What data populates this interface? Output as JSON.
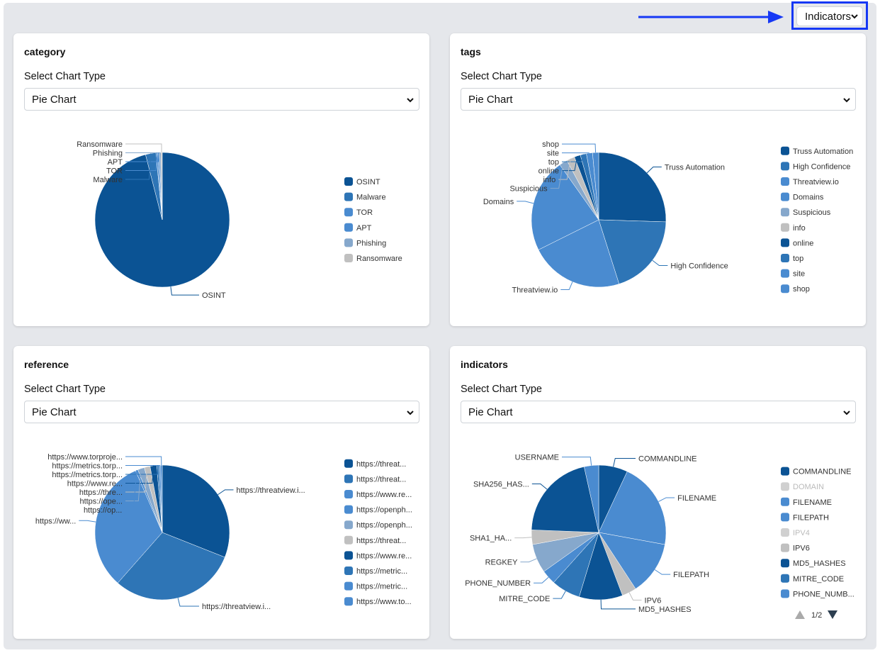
{
  "top_selector": {
    "value": "Indicators"
  },
  "cards": [
    {
      "title": "category",
      "select_label": "Select Chart Type",
      "chart_type": "Pie Chart"
    },
    {
      "title": "tags",
      "select_label": "Select Chart Type",
      "chart_type": "Pie Chart"
    },
    {
      "title": "reference",
      "select_label": "Select Chart Type",
      "chart_type": "Pie Chart"
    },
    {
      "title": "indicators",
      "select_label": "Select Chart Type",
      "chart_type": "Pie Chart"
    }
  ],
  "colors": [
    "#0b5394",
    "#2e75b6",
    "#4a8bd0",
    "#4a8bd0",
    "#86a8cc",
    "#c0c0c0",
    "#0b5394",
    "#2e75b6",
    "#4a8bd0",
    "#4a8bd0",
    "#86a8cc"
  ],
  "chart_data": [
    {
      "type": "pie",
      "title": "category",
      "categories": [
        "OSINT",
        "Malware",
        "TOR",
        "APT",
        "Phishing",
        "Ransomware"
      ],
      "values": [
        96,
        2.5,
        0.4,
        0.4,
        0.4,
        0.3
      ],
      "colors": [
        "#0b5394",
        "#2e75b6",
        "#4a8bd0",
        "#4a8bd0",
        "#86a8cc",
        "#c0c0c0"
      ],
      "legend": [
        "OSINT",
        "Malware",
        "TOR",
        "APT",
        "Phishing",
        "Ransomware"
      ],
      "legend_position": "right"
    },
    {
      "type": "pie",
      "title": "tags",
      "categories": [
        "Truss Automation",
        "High Confidence",
        "Threatview.io",
        "Domains",
        "Suspicious",
        "info",
        "online",
        "top",
        "site",
        "shop"
      ],
      "values": [
        26,
        20,
        23,
        23,
        2,
        2,
        1.5,
        1.5,
        1.5,
        1.5
      ],
      "colors": [
        "#0b5394",
        "#2e75b6",
        "#4a8bd0",
        "#4a8bd0",
        "#86a8cc",
        "#c0c0c0",
        "#0b5394",
        "#2e75b6",
        "#4a8bd0",
        "#4a8bd0"
      ],
      "legend": [
        "Truss Automation",
        "High Confidence",
        "Threatview.io",
        "Domains",
        "Suspicious",
        "info",
        "online",
        "top",
        "site",
        "shop"
      ],
      "legend_position": "right"
    },
    {
      "type": "pie",
      "title": "reference",
      "categories": [
        "https://threatview.i...",
        "https://threatview.i...",
        "https://ww...",
        "https://op...",
        "https://ope...",
        "https://thre...",
        "https://www.re...",
        "https://metrics.torp...",
        "https://metrics.torp...",
        "https://www.torproje..."
      ],
      "values": [
        31,
        30.5,
        32,
        0.6,
        1.6,
        1.4,
        1.6,
        0.5,
        0.4,
        0.4
      ],
      "colors": [
        "#0b5394",
        "#2e75b6",
        "#4a8bd0",
        "#4a8bd0",
        "#86a8cc",
        "#c0c0c0",
        "#0b5394",
        "#2e75b6",
        "#4a8bd0",
        "#4a8bd0"
      ],
      "legend": [
        "https://threat...",
        "https://threat...",
        "https://www.re...",
        "https://openph...",
        "https://openph...",
        "https://threat...",
        "https://www.re...",
        "https://metric...",
        "https://metric...",
        "https://www.to..."
      ],
      "legend_position": "right"
    },
    {
      "type": "pie",
      "title": "indicators",
      "categories": [
        "COMMANDLINE",
        "FILENAME",
        "FILEPATH",
        "IPV6",
        "MD5_HASHES",
        "MITRE_CODE",
        "PHONE_NUMBER",
        "REGKEY",
        "SHA1_HA...",
        "SHA256_HAS...",
        "USERNAME"
      ],
      "values": [
        2,
        6,
        3.7,
        1,
        3,
        2,
        1,
        2,
        1,
        6,
        1
      ],
      "colors": [
        "#0b5394",
        "#4a8bd0",
        "#4a8bd0",
        "#c0c0c0",
        "#0b5394",
        "#2e75b6",
        "#4a8bd0",
        "#86a8cc",
        "#c0c0c0",
        "#0b5394",
        "#4a8bd0"
      ],
      "legend": [
        "COMMANDLINE",
        "DOMAIN",
        "FILENAME",
        "FILEPATH",
        "IPV4",
        "IPV6",
        "MD5_HASHES",
        "MITRE_CODE",
        "PHONE_NUMB..."
      ],
      "legend_colors": [
        "#0b5394",
        "#d0d0d0",
        "#4a8bd0",
        "#4a8bd0",
        "#d0d0d0",
        "#c0c0c0",
        "#0b5394",
        "#2e75b6",
        "#4a8bd0"
      ],
      "legend_disabled": [
        false,
        true,
        false,
        false,
        true,
        false,
        false,
        false,
        false
      ],
      "legend_page": "1/2",
      "legend_position": "right"
    }
  ]
}
